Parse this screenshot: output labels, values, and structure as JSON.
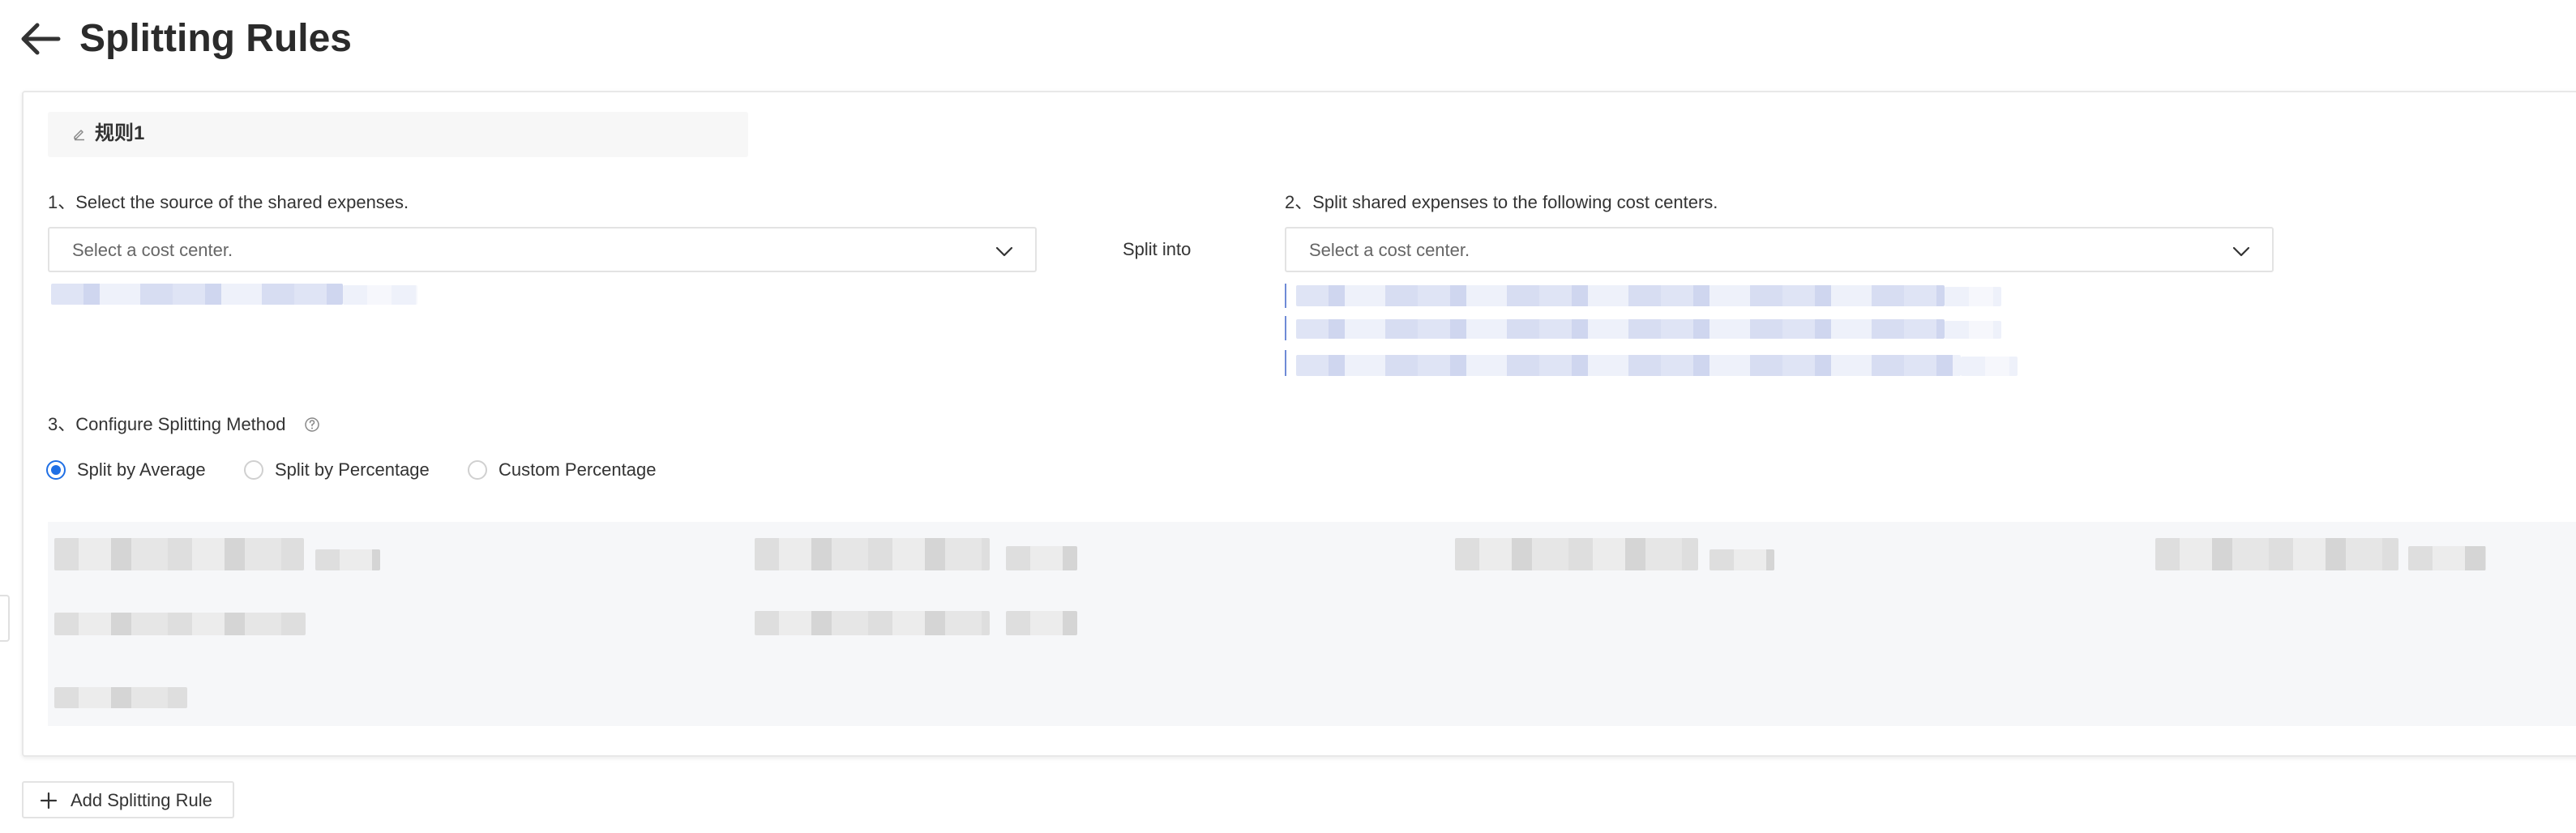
{
  "page": {
    "title": "Splitting Rules"
  },
  "icons": {
    "back": "arrow-left-icon",
    "edit": "pencil-icon",
    "chevron": "chevron-down-icon",
    "help": "help-circle-icon",
    "add": "plus-icon"
  },
  "colors": {
    "accent": "#1f6fe5",
    "panel_bg": "#f6f7f9"
  },
  "rule": {
    "name": "规则1",
    "step1": {
      "label": "1、Select the source of the shared expenses.",
      "placeholder": "Select a cost center."
    },
    "split_into": "Split into",
    "step2": {
      "label": "2、Split shared expenses to the following cost centers.",
      "placeholder": "Select a cost center."
    },
    "step3": {
      "label": "3、Configure Splitting Method",
      "options": [
        {
          "label": "Split by Average",
          "selected": true
        },
        {
          "label": "Split by Percentage",
          "selected": false
        },
        {
          "label": "Custom Percentage",
          "selected": false
        }
      ]
    }
  },
  "actions": {
    "add_rule": "Add Splitting Rule"
  }
}
